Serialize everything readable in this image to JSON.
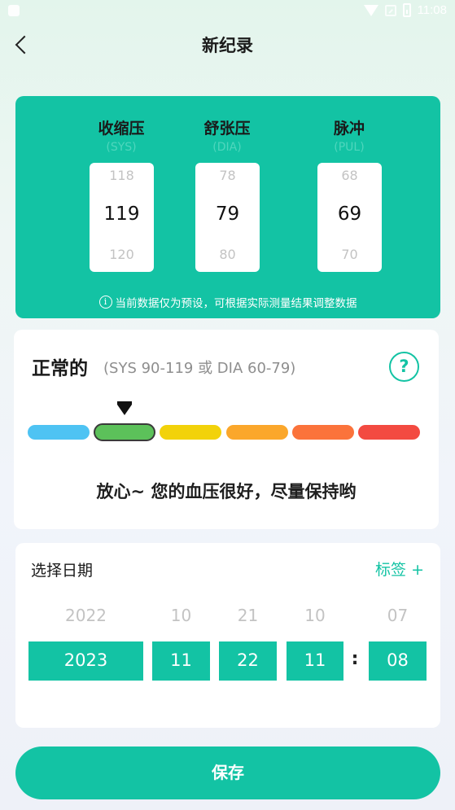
{
  "status_bar": {
    "time": "11:08"
  },
  "header": {
    "title": "新纪录"
  },
  "measurements": [
    {
      "label": "收缩压",
      "sub": "(SYS)",
      "prev": "118",
      "current": "119",
      "next": "120"
    },
    {
      "label": "舒张压",
      "sub": "(DIA)",
      "prev": "78",
      "current": "79",
      "next": "80"
    },
    {
      "label": "脉冲",
      "sub": "(PUL)",
      "prev": "68",
      "current": "69",
      "next": "70"
    }
  ],
  "notice": "当前数据仅为预设，可根据实际测量结果调整数据",
  "status": {
    "title": "正常的",
    "range": "(SYS 90-119 或 DIA 60-79)",
    "help": "?",
    "active_index": 1,
    "scale_colors": [
      "#4ec3f3",
      "#5cc15a",
      "#f2d20a",
      "#fba72b",
      "#fb733b",
      "#f34a41"
    ],
    "message": "放心~ 您的血压很好，尽量保持哟"
  },
  "date": {
    "title": "选择日期",
    "tag_label": "标签 +",
    "separator": ":",
    "year": {
      "prev": "2022",
      "current": "2023"
    },
    "month": {
      "prev": "10",
      "current": "11"
    },
    "day": {
      "prev": "21",
      "current": "22"
    },
    "hour": {
      "prev": "10",
      "current": "11"
    },
    "minute": {
      "prev": "07",
      "current": "08"
    }
  },
  "save_label": "保存"
}
